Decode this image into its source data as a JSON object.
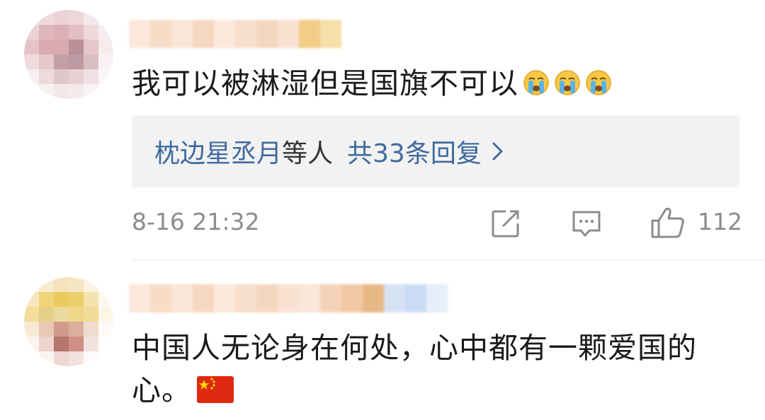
{
  "comments": [
    {
      "text": "我可以被淋湿但是国旗不可以",
      "emojis": [
        "cry-emoji",
        "cry-emoji",
        "cry-emoji"
      ],
      "reply_preview": {
        "names": "枕边星丞月",
        "etc": "等人",
        "total": "共33条回复"
      },
      "time": "8-16 21:32",
      "like_count": "112"
    },
    {
      "text_line1": "中国人无论身在何处，心中都有一颗爱国的",
      "text_line2": "心。",
      "emoji": "china-flag"
    }
  ],
  "colors": {
    "link": "#3f6a9e",
    "meta": "#8c8c8c",
    "reply_bg": "#f2f2f2"
  }
}
